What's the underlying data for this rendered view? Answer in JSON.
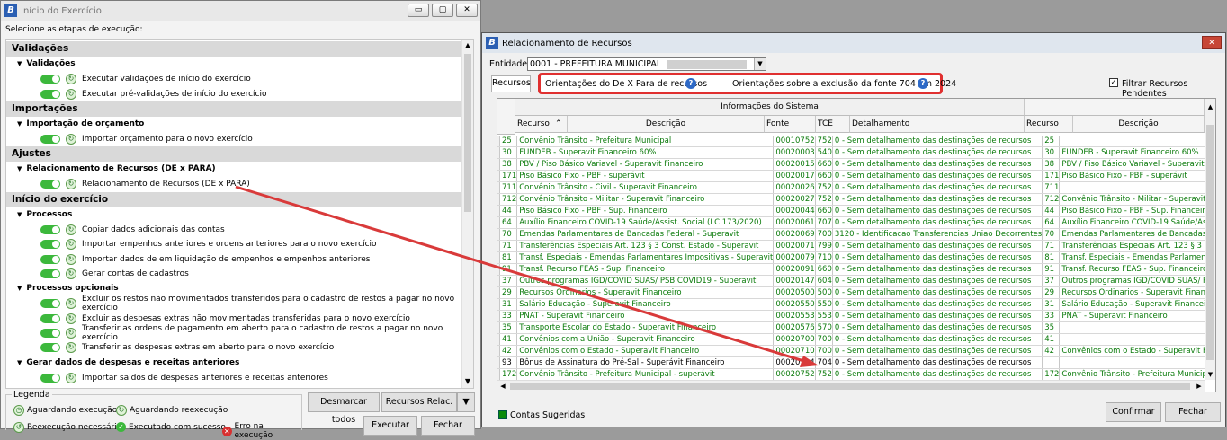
{
  "left": {
    "title": "Início do Exercício",
    "subtitle": "Selecione as etapas de execução:",
    "sections": [
      {
        "title": "Validações",
        "groups": [
          {
            "title": "Validações",
            "items": [
              "Executar validações de início do exercício",
              "Executar pré-validações de início do exercício"
            ]
          }
        ]
      },
      {
        "title": "Importações",
        "groups": [
          {
            "title": "Importação de orçamento",
            "items": [
              "Importar orçamento para o novo exercício"
            ]
          }
        ]
      },
      {
        "title": "Ajustes",
        "groups": [
          {
            "title": "Relacionamento de Recursos (DE x PARA)",
            "items": [
              "Relacionamento de Recursos (DE x PARA)"
            ]
          }
        ]
      },
      {
        "title": "Início do exercício",
        "groups": [
          {
            "title": "Processos",
            "items": [
              "Copiar dados adicionais das contas",
              "Importar empenhos anteriores e ordens anteriores para o novo exercício",
              "Importar dados de em liquidação de empenhos e empenhos anteriores",
              "Gerar contas de cadastros"
            ]
          },
          {
            "title": "Processos opcionais",
            "items": [
              "Excluir os restos não movimentados transferidos para o cadastro de restos a pagar no novo exercício",
              "Excluir as despesas extras não movimentadas transferidas para o novo exercício",
              "Transferir as ordens de pagamento em aberto para o cadastro de restos a pagar no novo exercício",
              "Transferir as despesas extras em aberto para o novo exercício"
            ]
          },
          {
            "title": "Gerar dados de despesas e receitas anteriores",
            "items": [
              "Importar saldos de despesas anteriores e receitas anteriores"
            ]
          }
        ]
      }
    ],
    "legend_title": "Legenda",
    "legend": [
      "Aguardando execução",
      "Aguardando reexecução",
      "Reexecução necessária",
      "Executado com sucesso",
      "Erro na execução"
    ],
    "buttons": {
      "desmarcar": "Desmarcar todos",
      "recursos": "Recursos Relac.",
      "executar": "Executar",
      "fechar": "Fechar"
    }
  },
  "right": {
    "title": "Relacionamento de Recursos",
    "entidade_label": "Entidade:",
    "entidade_value": "0001 - PREFEITURA MUNICIPAL",
    "tab": "Recursos",
    "link1": "Orientações do De X Para de recursos",
    "link2": "Orientações sobre a exclusão da fonte 704 em 2024",
    "filter_label": "Filtrar Recursos Pendentes",
    "group_header": "Informações do Sistema",
    "columns": [
      "Recurso",
      "Descrição",
      "Fonte",
      "TCE",
      "Detalhamento",
      "Recurso",
      "Descrição"
    ],
    "rows": [
      [
        "25",
        "Convênio Trânsito - Prefeitura Municipal",
        "00010752",
        "752",
        "0 - Sem detalhamento das destinações de recursos",
        "25",
        ""
      ],
      [
        "30",
        "FUNDEB - Superavit Financeiro 60%",
        "00020003",
        "540",
        "0 - Sem detalhamento das destinações de recursos",
        "30",
        "FUNDEB - Superavit Financeiro 60%"
      ],
      [
        "38",
        "PBV / Piso  Básico Variavel - Superavit Financeiro",
        "00020015",
        "660",
        "0 - Sem detalhamento das destinações de recursos",
        "38",
        "PBV / Piso  Básico Variavel - Superavit Financeiro"
      ],
      [
        "171",
        "Piso Básico Fixo - PBF - superávit",
        "00020017",
        "660",
        "0 - Sem detalhamento das destinações de recursos",
        "171",
        "Piso Básico Fixo - PBF - superávit"
      ],
      [
        "711",
        "Convênio Trânsito - Civil - Superavit Financeiro",
        "00020026",
        "752",
        "0 - Sem detalhamento das destinações de recursos",
        "711",
        ""
      ],
      [
        "712",
        "Convênio Trânsito - Militar - Superavit Financeiro",
        "00020027",
        "752",
        "0 - Sem detalhamento das destinações de recursos",
        "712",
        "Convênio Trânsito - Militar - Superavit Financeiro"
      ],
      [
        "44",
        "Piso Básico Fixo - PBF - Sup. Financeiro",
        "00020044",
        "660",
        "0 - Sem detalhamento das destinações de recursos",
        "44",
        "Piso Básico Fixo - PBF - Sup. Financeiro"
      ],
      [
        "64",
        "Auxílio Financeiro COVID-19 Saúde/Assist. Social (LC 173/2020)",
        "00020061",
        "707",
        "0 - Sem detalhamento das destinações de recursos",
        "64",
        "Auxílio Financeiro COVID-19 Saúde/Assist. Social"
      ],
      [
        "70",
        "Emendas Parlamentares de Bancadas Federal - Superavit",
        "00020069",
        "700",
        "3120 - Identificacao Transferencias Uniao Decorrentes",
        "70",
        "Emendas Parlamentares de Bancadas Federal"
      ],
      [
        "71",
        "Transferências Especiais Art. 123  § 3 Const. Estado - Superavit",
        "00020071",
        "799",
        "0 - Sem detalhamento das destinações de recursos",
        "71",
        "Transferências Especiais Art. 123  § 3 Const."
      ],
      [
        "81",
        "Transf. Especiais - Emendas Parlamentares Impositivas - Superavit",
        "00020079",
        "710",
        "0 - Sem detalhamento das destinações de recursos",
        "81",
        "Transf. Especiais - Emendas Parlamentares"
      ],
      [
        "91",
        "Transf. Recurso FEAS - Sup. Financeiro",
        "00020091",
        "660",
        "0 - Sem detalhamento das destinações de recursos",
        "91",
        "Transf. Recurso FEAS - Sup. Financeiro"
      ],
      [
        "37",
        "Outros programas IGD/COVID SUAS/ PSB COVID19 - Superavit",
        "00020147",
        "604",
        "0 - Sem detalhamento das destinações de recursos",
        "37",
        "Outros programas IGD/COVID SUAS/ PSB COVID19"
      ],
      [
        "29",
        "Recursos Ordinarios - Superavit Financeiro",
        "00020500",
        "500",
        "0 - Sem detalhamento das destinações de recursos",
        "29",
        "Recursos Ordinarios - Superavit Financeiro"
      ],
      [
        "31",
        "Salário Educação - Superavit Financeiro",
        "00020550",
        "550",
        "0 - Sem detalhamento das destinações de recursos",
        "31",
        "Salário Educação - Superavit Financeiro"
      ],
      [
        "33",
        "PNAT - Superavit Financeiro",
        "00020553",
        "553",
        "0 - Sem detalhamento das destinações de recursos",
        "33",
        "PNAT - Superavit Financeiro"
      ],
      [
        "35",
        "Transporte Escolar do Estado - Superavit Financeiro",
        "00020576",
        "570",
        "0 - Sem detalhamento das destinações de recursos",
        "35",
        ""
      ],
      [
        "41",
        "Convênios com a União - Superavit Financeiro",
        "00020700",
        "700",
        "0 - Sem detalhamento das destinações de recursos",
        "41",
        ""
      ],
      [
        "42",
        "Convênios com o Estado - Superavit Financeiro",
        "00020710",
        "700",
        "0 - Sem detalhamento das destinações de recursos",
        "42",
        "Convênios com o Estado - Superavit Financeiro"
      ],
      [
        "93",
        "Bônus de Assinatura do Pré-Sal - Superávit Financeiro",
        "00020704",
        "704",
        "0 - Sem detalhamento das destinações de recursos",
        "",
        ""
      ],
      [
        "172",
        "Convênio Trânsito - Prefeitura Municipal - superávit",
        "00020752",
        "752",
        "0 - Sem detalhamento das destinações de recursos",
        "172",
        "Convênio Trânsito - Prefeitura Municipal"
      ]
    ],
    "legend_label": "Contas Sugeridas",
    "confirm": "Confirmar",
    "close": "Fechar",
    "colors": {
      "suggested": "#0a7a0a",
      "highlight": "#e03030",
      "arrow": "#d93a3a"
    }
  }
}
